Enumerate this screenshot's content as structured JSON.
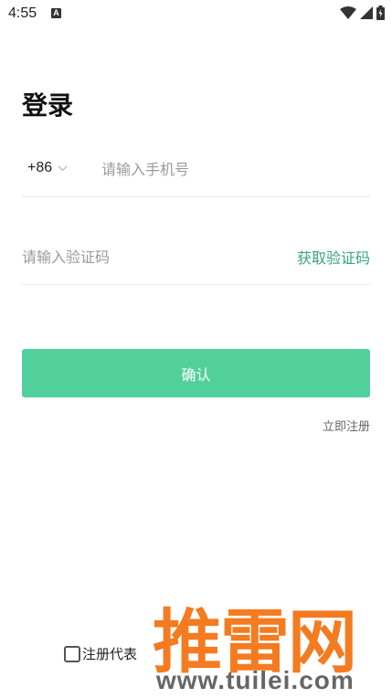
{
  "status_bar": {
    "time": "4:55",
    "notification_icon": "A"
  },
  "page": {
    "title": "登录"
  },
  "phone_row": {
    "country_code": "+86",
    "placeholder": "请输入手机号"
  },
  "code_row": {
    "placeholder": "请输入验证码",
    "get_code_label": "获取验证码"
  },
  "confirm_label": "确认",
  "register_label": "立即注册",
  "agreement_text": "注册代表",
  "watermark": {
    "brand": "推雷网",
    "url": "www.tuilei.com"
  },
  "colors": {
    "accent": "#52d09c",
    "link": "#3aa57a",
    "watermark": "#f47b20"
  }
}
